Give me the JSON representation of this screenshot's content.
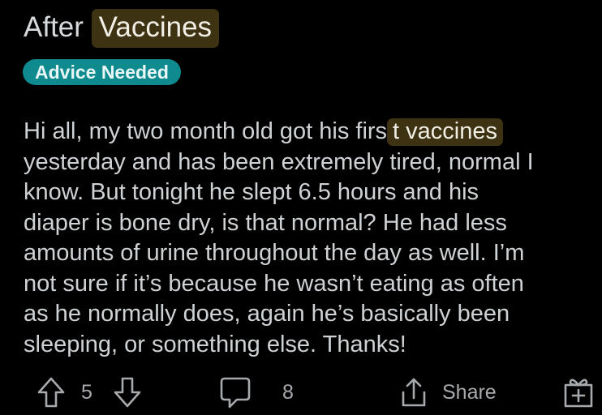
{
  "post": {
    "title_prefix": "After ",
    "title_highlight": "Vaccines",
    "flair": "Advice Needed",
    "body": {
      "line1_prefix": "Hi all, my two month old got his firs",
      "line1_highlight": "t vaccines",
      "lines": [
        "yesterday and has been extremely tired, normal I",
        "know. But tonight he slept 6.5 hours and his",
        "diaper is bone dry, is that normal? He had less",
        "amounts of urine throughout the day as well. I’m",
        "not sure if it’s because he wasn’t eating as often",
        "as he normally does, again he’s basically been",
        "sleeping, or something else. Thanks!"
      ]
    }
  },
  "actions": {
    "vote_count": "5",
    "comment_count": "8",
    "share_label": "Share"
  },
  "icons": {
    "upvote": "arrow-up-icon",
    "downvote": "arrow-down-icon",
    "comment": "speech-bubble-icon",
    "share": "share-icon",
    "award": "gift-icon"
  },
  "colors": {
    "background": "#000000",
    "text": "#d7dadc",
    "highlight": "#3d3212",
    "flair": "#0f8a8f",
    "icons": "#a7aaad"
  }
}
